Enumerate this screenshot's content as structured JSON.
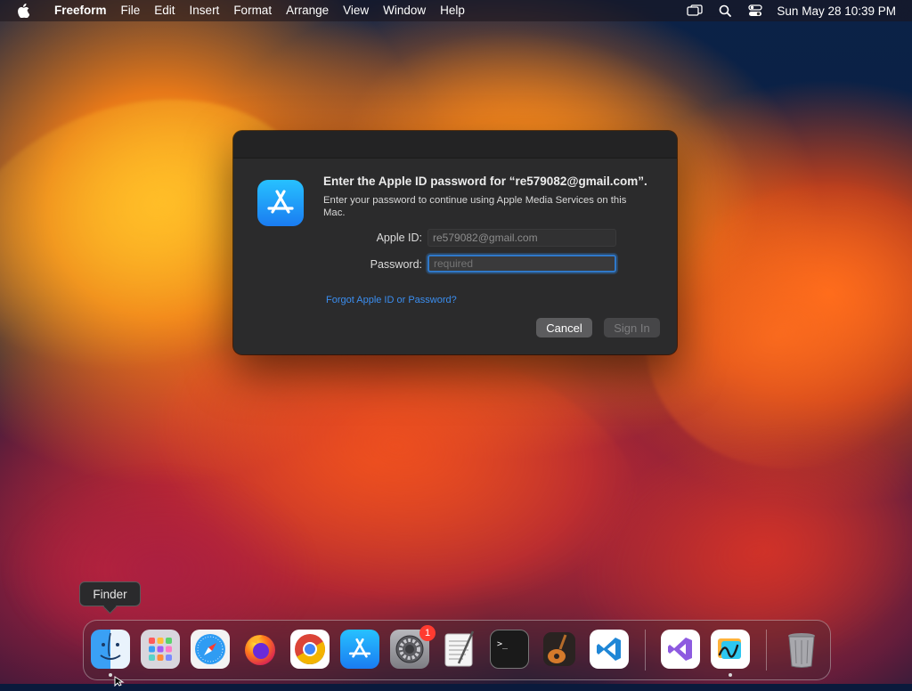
{
  "menubar": {
    "app_name": "Freeform",
    "items": [
      "File",
      "Edit",
      "Insert",
      "Format",
      "Arrange",
      "View",
      "Window",
      "Help"
    ],
    "clock": "Sun May 28  10:39 PM",
    "icons": [
      "apple-logo-icon",
      "screen-mirroring-icon",
      "search-icon",
      "control-center-icon"
    ]
  },
  "dialog": {
    "title": "Enter the Apple ID password for “re579082@gmail.com”.",
    "subtitle": "Enter your password to continue using Apple Media Services on this Mac.",
    "apple_id_label": "Apple ID:",
    "apple_id_value": "re579082@gmail.com",
    "password_label": "Password:",
    "password_placeholder": "required",
    "password_value": "",
    "forgot_link": "Forgot Apple ID or Password?",
    "cancel_label": "Cancel",
    "signin_label": "Sign In",
    "app_icon": "app-store-icon"
  },
  "tooltip": {
    "text": "Finder"
  },
  "dock": {
    "apps": [
      {
        "name": "Finder",
        "icon": "finder-icon",
        "running": true
      },
      {
        "name": "Launchpad",
        "icon": "launchpad-icon",
        "running": false
      },
      {
        "name": "Safari",
        "icon": "safari-icon",
        "running": false
      },
      {
        "name": "Firefox",
        "icon": "firefox-icon",
        "running": false
      },
      {
        "name": "Google Chrome",
        "icon": "chrome-icon",
        "running": false
      },
      {
        "name": "App Store",
        "icon": "app-store-icon",
        "running": false
      },
      {
        "name": "System Settings",
        "icon": "system-settings-icon",
        "running": false,
        "badge": "1"
      },
      {
        "name": "TextEdit",
        "icon": "textedit-icon",
        "running": false
      },
      {
        "name": "Terminal",
        "icon": "terminal-icon",
        "running": false
      },
      {
        "name": "GarageBand",
        "icon": "garageband-icon",
        "running": false
      },
      {
        "name": "Visual Studio Code",
        "icon": "vscode-icon",
        "running": false
      },
      {
        "name": "Visual Studio",
        "icon": "visual-studio-icon",
        "running": false
      },
      {
        "name": "Freeform",
        "icon": "freeform-icon",
        "running": true
      },
      {
        "name": "Trash",
        "icon": "trash-icon",
        "running": false
      }
    ]
  },
  "colors": {
    "accent": "#2f78c9",
    "link": "#3b8ef0",
    "badge": "#ff3b30"
  }
}
